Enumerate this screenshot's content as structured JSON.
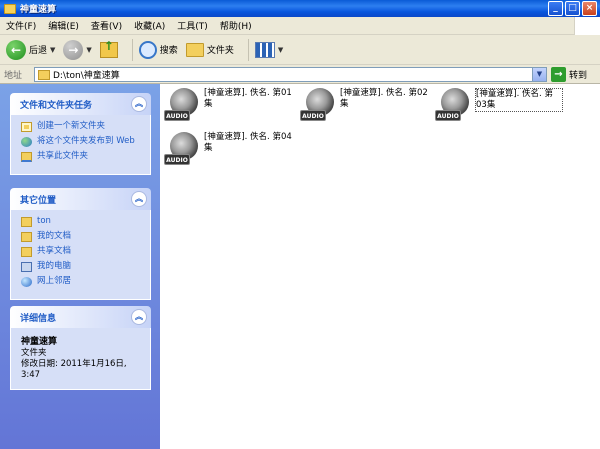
{
  "window": {
    "title": "神童速算"
  },
  "menu": [
    "文件(F)",
    "编辑(E)",
    "查看(V)",
    "收藏(A)",
    "工具(T)",
    "帮助(H)"
  ],
  "toolbar": {
    "back_label": "后退",
    "search_label": "搜索",
    "folders_label": "文件夹"
  },
  "address": {
    "label": "地址",
    "path": "D:\\ton\\神童速算",
    "go_label": "转到"
  },
  "taskpane": {
    "file_tasks": {
      "title": "文件和文件夹任务",
      "items": [
        "创建一个新文件夹",
        "将这个文件夹发布到 Web",
        "共享此文件夹"
      ]
    },
    "other_places": {
      "title": "其它位置",
      "items": [
        "ton",
        "我的文档",
        "共享文档",
        "我的电脑",
        "网上邻居"
      ]
    },
    "details": {
      "title": "详细信息",
      "name": "神童速算",
      "type": "文件夹",
      "modified": "修改日期: 2011年1月16日, 3:47"
    }
  },
  "files": [
    {
      "icon": "audio-icon",
      "badge": "AUDIO",
      "name": "[神童速算]. 佚名. 第01集"
    },
    {
      "icon": "audio-icon",
      "badge": "AUDIO",
      "name": "[神童速算]. 佚名. 第02集"
    },
    {
      "icon": "audio-icon",
      "badge": "AUDIO",
      "name": "[神童速算]. 佚名. 第03集"
    },
    {
      "icon": "audio-icon",
      "badge": "AUDIO",
      "name": "[神童速算]. 佚名. 第04集"
    }
  ]
}
